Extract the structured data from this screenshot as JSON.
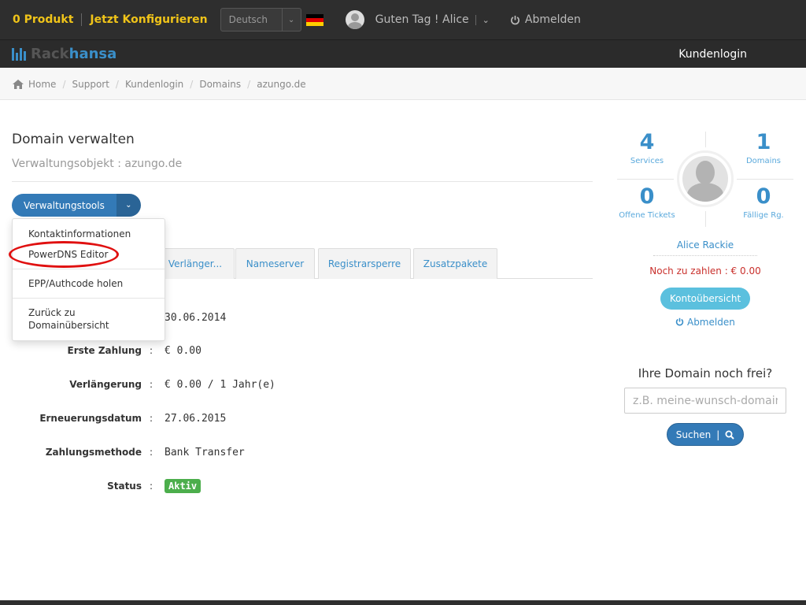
{
  "topbar": {
    "cart_label": "0 Produkt",
    "configure_label": "Jetzt Konfigurieren",
    "language_selected": "Deutsch",
    "greeting": "Guten Tag ! Alice",
    "logout_label": "Abmelden"
  },
  "brand": {
    "name_part1": "Rack",
    "name_part2": "hansa",
    "accent_color": "#3a8fc9",
    "kundenlogin_label": "Kundenlogin"
  },
  "breadcrumb": [
    "Home",
    "Support",
    "Kundenlogin",
    "Domains",
    "azungo.de"
  ],
  "main": {
    "title": "Domain verwalten",
    "subtitle": "Verwaltungsobjekt : azungo.de",
    "tools_button": "Verwaltungstools",
    "dropdown_items": [
      "Kontaktinformationen",
      "PowerDNS Editor",
      "EPP/Authcode holen",
      "Zurück zu Domainübersicht"
    ],
    "tabs": [
      "Verlänger...",
      "Nameserver",
      "Registrarsperre",
      "Zusatzpakete"
    ],
    "details": [
      {
        "label": "",
        "value": "30.06.2014"
      },
      {
        "label": "Erste Zahlung",
        "value": "€ 0.00"
      },
      {
        "label": "Verlängerung",
        "value": "€ 0.00 / 1 Jahr(e)"
      },
      {
        "label": "Erneuerungsdatum",
        "value": "27.06.2015"
      },
      {
        "label": "Zahlungsmethode",
        "value": "Bank Transfer"
      },
      {
        "label": "Status",
        "value": "Aktiv"
      }
    ],
    "colon": ":"
  },
  "sidebar": {
    "stats": [
      {
        "value": "4",
        "label": "Services"
      },
      {
        "value": "1",
        "label": "Domains"
      },
      {
        "value": "0",
        "label": "Offene Tickets"
      },
      {
        "value": "0",
        "label": "Fällige Rg."
      }
    ],
    "user_name": "Alice Rackie",
    "due_text": "Noch zu zahlen : € 0.00",
    "account_button": "Kontoübersicht",
    "logout_label": "Abmelden",
    "domain_question": "Ihre Domain noch frei?",
    "domain_placeholder": "z.B. meine-wunsch-domain",
    "search_button": "Suchen",
    "search_sep": "|"
  }
}
